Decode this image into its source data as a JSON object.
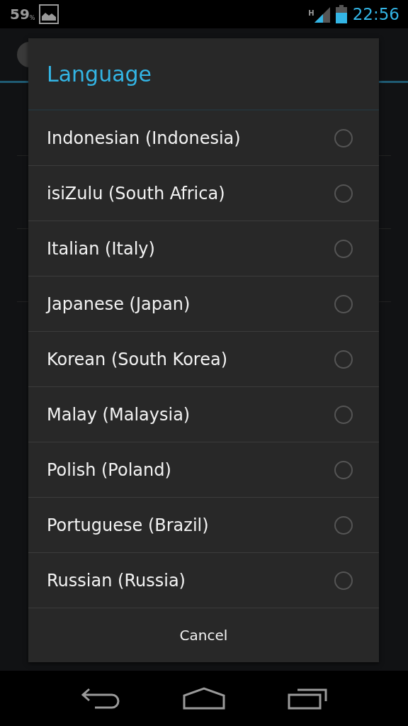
{
  "status_bar": {
    "battery_percent": "59",
    "percent_sign": "%",
    "network_type": "H",
    "time": "22:56"
  },
  "dialog": {
    "title": "Language",
    "options": [
      {
        "label": "Indonesian (Indonesia)",
        "selected": false
      },
      {
        "label": "isiZulu (South Africa)",
        "selected": false
      },
      {
        "label": "Italian (Italy)",
        "selected": false
      },
      {
        "label": "Japanese (Japan)",
        "selected": false
      },
      {
        "label": "Korean (South Korea)",
        "selected": false
      },
      {
        "label": "Malay (Malaysia)",
        "selected": false
      },
      {
        "label": "Polish (Poland)",
        "selected": false
      },
      {
        "label": "Portuguese (Brazil)",
        "selected": false
      },
      {
        "label": "Russian (Russia)",
        "selected": false
      }
    ],
    "cancel_button": "Cancel"
  }
}
